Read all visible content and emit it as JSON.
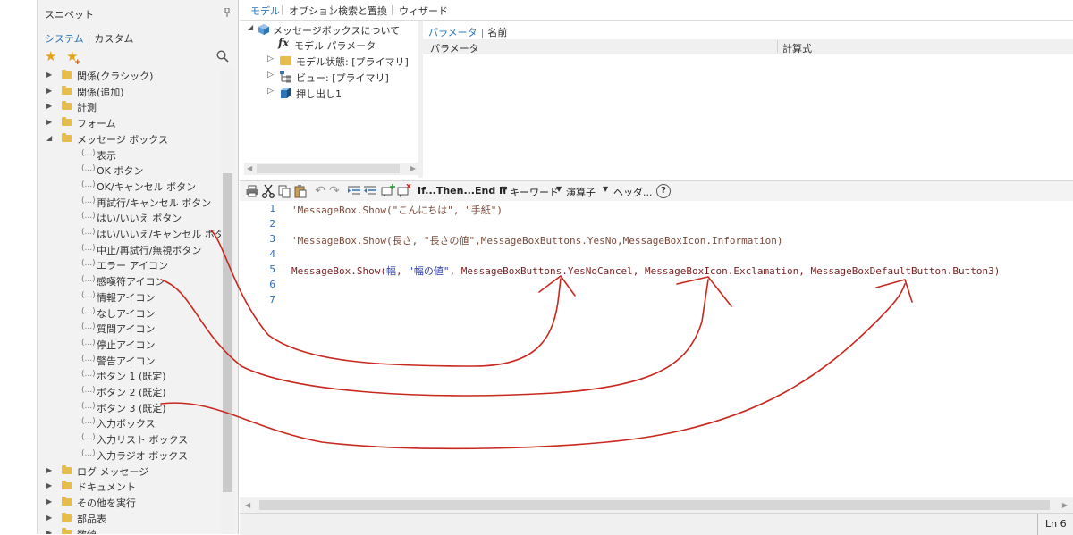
{
  "snippet_panel": {
    "title": "スニペット",
    "tabs": {
      "system": "システム",
      "separator": "|",
      "custom": "カスタム"
    },
    "tree_items": [
      {
        "type": "folder",
        "label": "関係(クラシック)"
      },
      {
        "type": "folder",
        "label": "関係(追加)"
      },
      {
        "type": "folder",
        "label": "計測"
      },
      {
        "type": "folder",
        "label": "フォーム"
      },
      {
        "type": "folder-open",
        "label": "メッセージ ボックス"
      },
      {
        "type": "leaf",
        "label": "表示"
      },
      {
        "type": "leaf",
        "label": "OK ボタン"
      },
      {
        "type": "leaf",
        "label": "OK/キャンセル ボタン"
      },
      {
        "type": "leaf",
        "label": "再試行/キャンセル ボタン"
      },
      {
        "type": "leaf",
        "label": "はい/いいえ ボタン"
      },
      {
        "type": "leaf",
        "label": "はい/いいえ/キャンセル ボタン"
      },
      {
        "type": "leaf",
        "label": "中止/再試行/無視ボタン"
      },
      {
        "type": "leaf",
        "label": "エラー アイコン"
      },
      {
        "type": "leaf",
        "label": "感嘆符アイコン"
      },
      {
        "type": "leaf",
        "label": "情報アイコン"
      },
      {
        "type": "leaf",
        "label": "なしアイコン"
      },
      {
        "type": "leaf",
        "label": "質問アイコン"
      },
      {
        "type": "leaf",
        "label": "停止アイコン"
      },
      {
        "type": "leaf",
        "label": "警告アイコン"
      },
      {
        "type": "leaf",
        "label": "ボタン 1 (既定)"
      },
      {
        "type": "leaf",
        "label": "ボタン 2 (既定)"
      },
      {
        "type": "leaf",
        "label": "ボタン 3 (既定)"
      },
      {
        "type": "leaf",
        "label": "入力ボックス"
      },
      {
        "type": "leaf",
        "label": "入力リスト ボックス"
      },
      {
        "type": "leaf",
        "label": "入力ラジオ ボックス"
      },
      {
        "type": "folder",
        "label": "ログ メッセージ"
      },
      {
        "type": "folder",
        "label": "ドキュメント"
      },
      {
        "type": "folder",
        "label": "その他を実行"
      },
      {
        "type": "folder",
        "label": "部品表"
      },
      {
        "type": "folder",
        "label": "数値"
      }
    ]
  },
  "top_menu": {
    "items": [
      "モデル",
      "オプション",
      "検索と置換",
      "ウィザード"
    ],
    "separator": "|"
  },
  "model_tree": {
    "root": "メッセージボックスについて",
    "children": [
      {
        "label": "モデル パラメータ",
        "expandable": false
      },
      {
        "label": "モデル状態: [プライマリ]",
        "expandable": true
      },
      {
        "label": "ビュー: [プライマリ]",
        "expandable": true
      },
      {
        "label": "押し出し1",
        "expandable": true
      }
    ]
  },
  "param_panel": {
    "tabs": [
      "パラメータ",
      "名前"
    ],
    "separator": "|",
    "columns": [
      "パラメータ",
      "計算式"
    ]
  },
  "toolbar": {
    "if_then": "If...Then...End If",
    "keyword": "キーワード",
    "operator": "演算子",
    "header": "ヘッダ...",
    "help": "?"
  },
  "code": {
    "line_numbers": [
      "1",
      "2",
      "3",
      "4",
      "5",
      "6",
      "7"
    ],
    "line1": "'MessageBox.Show(\"こんにちは\", \"手紙\")",
    "line3": "'MessageBox.Show(長さ, \"長さの値\",MessageBoxButtons.YesNo,MessageBoxIcon.Information)",
    "line5": {
      "part1": "MessageBox.Show(",
      "width": "幅",
      "part2": ", ",
      "str": "\"幅の値\"",
      "part3": ", MessageBoxButtons.YesNoCancel, MessageBoxIcon.Exclamation, MessageBoxDefaultButton.Button3)"
    }
  },
  "status_bar": {
    "line_indicator": "Ln 6"
  },
  "colors": {
    "accent_blue": "#2e75b6",
    "folder_yellow": "#e6bc4a",
    "annotation_red": "#c8281e",
    "code_red": "#7a1f1f",
    "code_string_blue": "#2a3eaa"
  }
}
